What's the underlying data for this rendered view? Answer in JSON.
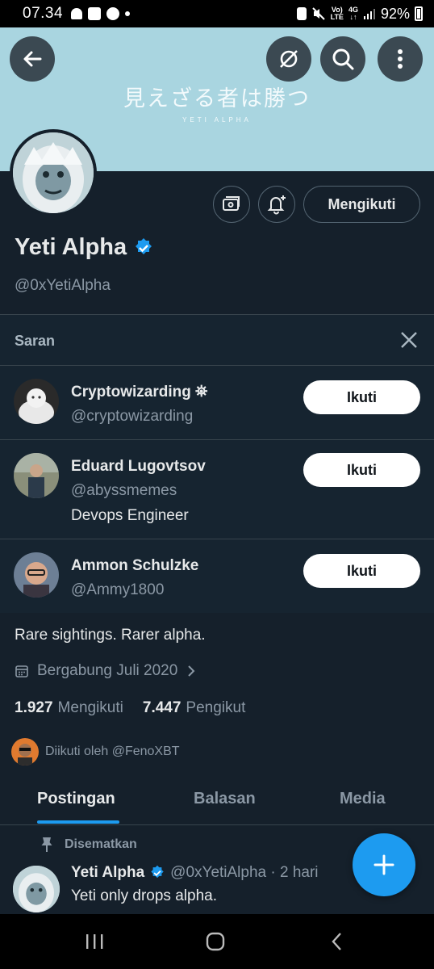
{
  "status_bar": {
    "time": "07.34",
    "battery": "92%"
  },
  "banner": {
    "title_jp": "見えざる者は勝つ",
    "subtitle": "YETI ALPHA"
  },
  "profile": {
    "name": "Yeti Alpha",
    "handle": "@0xYetiAlpha",
    "follow_state_label": "Mengikuti",
    "bio": "Rare sightings. Rarer alpha.",
    "joined": "Bergabung Juli 2020",
    "following_count": "1.927",
    "following_label": "Mengikuti",
    "followers_count": "7.447",
    "followers_label": "Pengikut",
    "followed_by": "Diikuti oleh @FenoXBT"
  },
  "suggestions": {
    "title": "Saran",
    "items": [
      {
        "name": "Cryptowizarding ⛯",
        "handle": "@cryptowizarding",
        "bio": "",
        "button": "Ikuti"
      },
      {
        "name": "Eduard Lugovtsov",
        "handle": "@abyssmemes",
        "bio": "Devops Engineer",
        "button": "Ikuti"
      },
      {
        "name": "Ammon Schulzke",
        "handle": "@Ammy1800",
        "bio": "",
        "button": "Ikuti"
      }
    ]
  },
  "tabs": [
    {
      "label": "Postingan",
      "active": true
    },
    {
      "label": "Balasan",
      "active": false
    },
    {
      "label": "Media",
      "active": false
    }
  ],
  "pinned_post": {
    "pinned_label": "Disematkan",
    "author": "Yeti Alpha",
    "handle_time": "@0xYetiAlpha · 2 hari",
    "text": "Yeti only drops alpha."
  },
  "colors": {
    "accent": "#1d9bf0",
    "background": "#15202b",
    "muted": "#8b98a5"
  }
}
